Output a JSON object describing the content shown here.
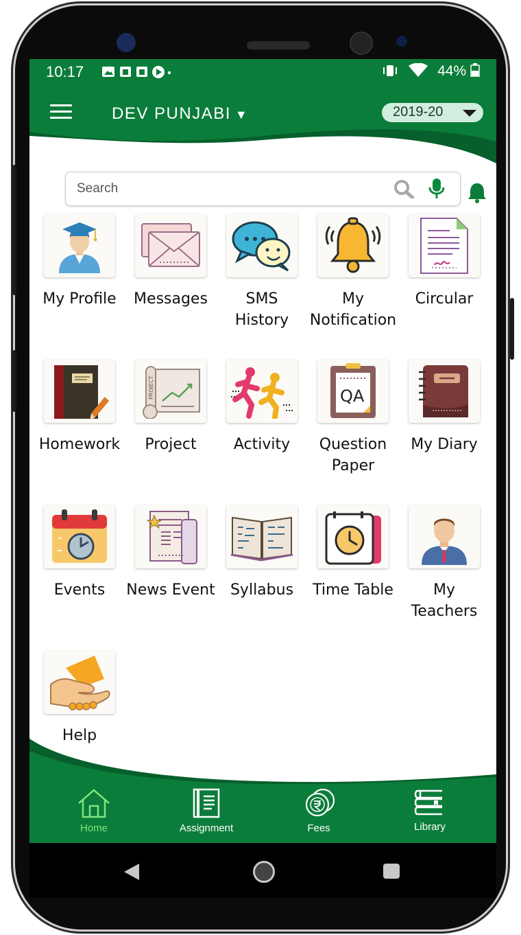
{
  "status_bar": {
    "time": "10:17",
    "battery": "44%"
  },
  "header": {
    "school": "DEV  PUNJABI",
    "year": "2019-20"
  },
  "search": {
    "placeholder": "Search"
  },
  "tiles": [
    {
      "label": "My Profile",
      "icon": "graduate-icon"
    },
    {
      "label": "Messages",
      "icon": "envelope-icon"
    },
    {
      "label": "SMS History",
      "icon": "chat-bubbles-icon"
    },
    {
      "label": "My Notification",
      "icon": "bell-icon"
    },
    {
      "label": "Circular",
      "icon": "document-icon"
    },
    {
      "label": "Homework",
      "icon": "notebook-pencil-icon"
    },
    {
      "label": "Project",
      "icon": "project-chart-icon"
    },
    {
      "label": "Activity",
      "icon": "runners-icon"
    },
    {
      "label": "Question Paper",
      "icon": "qa-paper-icon"
    },
    {
      "label": "My Diary",
      "icon": "diary-icon"
    },
    {
      "label": "Events",
      "icon": "calendar-clock-icon"
    },
    {
      "label": "News Event",
      "icon": "newspaper-icon"
    },
    {
      "label": "Syllabus",
      "icon": "open-book-icon"
    },
    {
      "label": "Time Table",
      "icon": "alarm-clock-icon"
    },
    {
      "label": "My Teachers",
      "icon": "teacher-icon"
    },
    {
      "label": "Help",
      "icon": "helping-hand-icon"
    }
  ],
  "bottom_nav": [
    {
      "label": "Home",
      "icon": "home-icon",
      "active": true
    },
    {
      "label": "Assignment",
      "icon": "assignment-icon",
      "active": false
    },
    {
      "label": "Fees",
      "icon": "coins-icon",
      "active": false
    },
    {
      "label": "Library",
      "icon": "books-icon",
      "active": false
    }
  ],
  "colors": {
    "primary_green": "#0b7d3a",
    "dark_green": "#075f2c",
    "active_nav": "#7fe27f"
  }
}
